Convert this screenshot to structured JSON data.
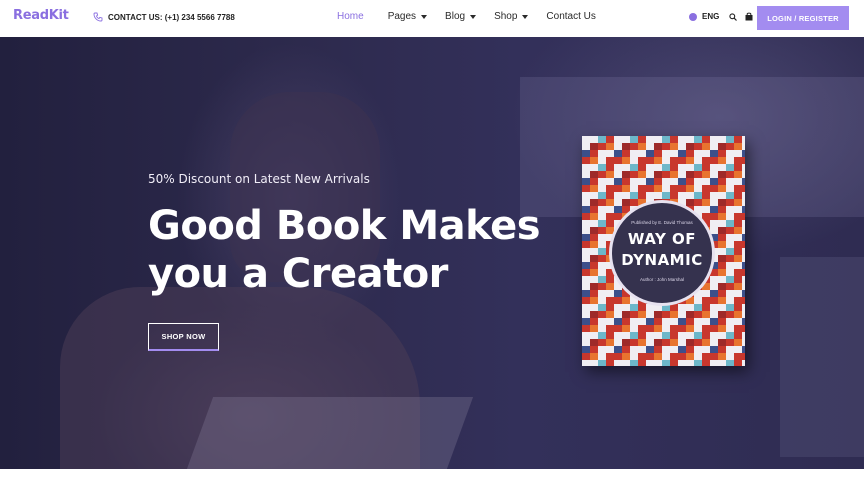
{
  "header": {
    "logo": "ReadKit",
    "contact": "CONTACT US: (+1) 234 5566 7788",
    "nav": [
      {
        "label": "Home",
        "active": true,
        "has_caret": false
      },
      {
        "label": "Pages",
        "active": false,
        "has_caret": true
      },
      {
        "label": "Blog",
        "active": false,
        "has_caret": true
      },
      {
        "label": "Shop",
        "active": false,
        "has_caret": true
      },
      {
        "label": "Contact Us",
        "active": false,
        "has_caret": false
      }
    ],
    "language": "ENG",
    "login_label": "LOGIN / REGISTER"
  },
  "hero": {
    "discount": "50% Discount on Latest New Arrivals",
    "headline_line1": "Good Book Makes",
    "headline_line2": "you a Creator",
    "cta": "SHOP NOW"
  },
  "book": {
    "publisher": "Published by E. David Thomas",
    "title_line1": "WAY OF",
    "title_line2": "DYNAMIC",
    "author": "Author : John Marshal"
  },
  "colors": {
    "accent": "#8a6fe0",
    "button": "#a38cf0",
    "hero_overlay": "#2d2a4d"
  }
}
